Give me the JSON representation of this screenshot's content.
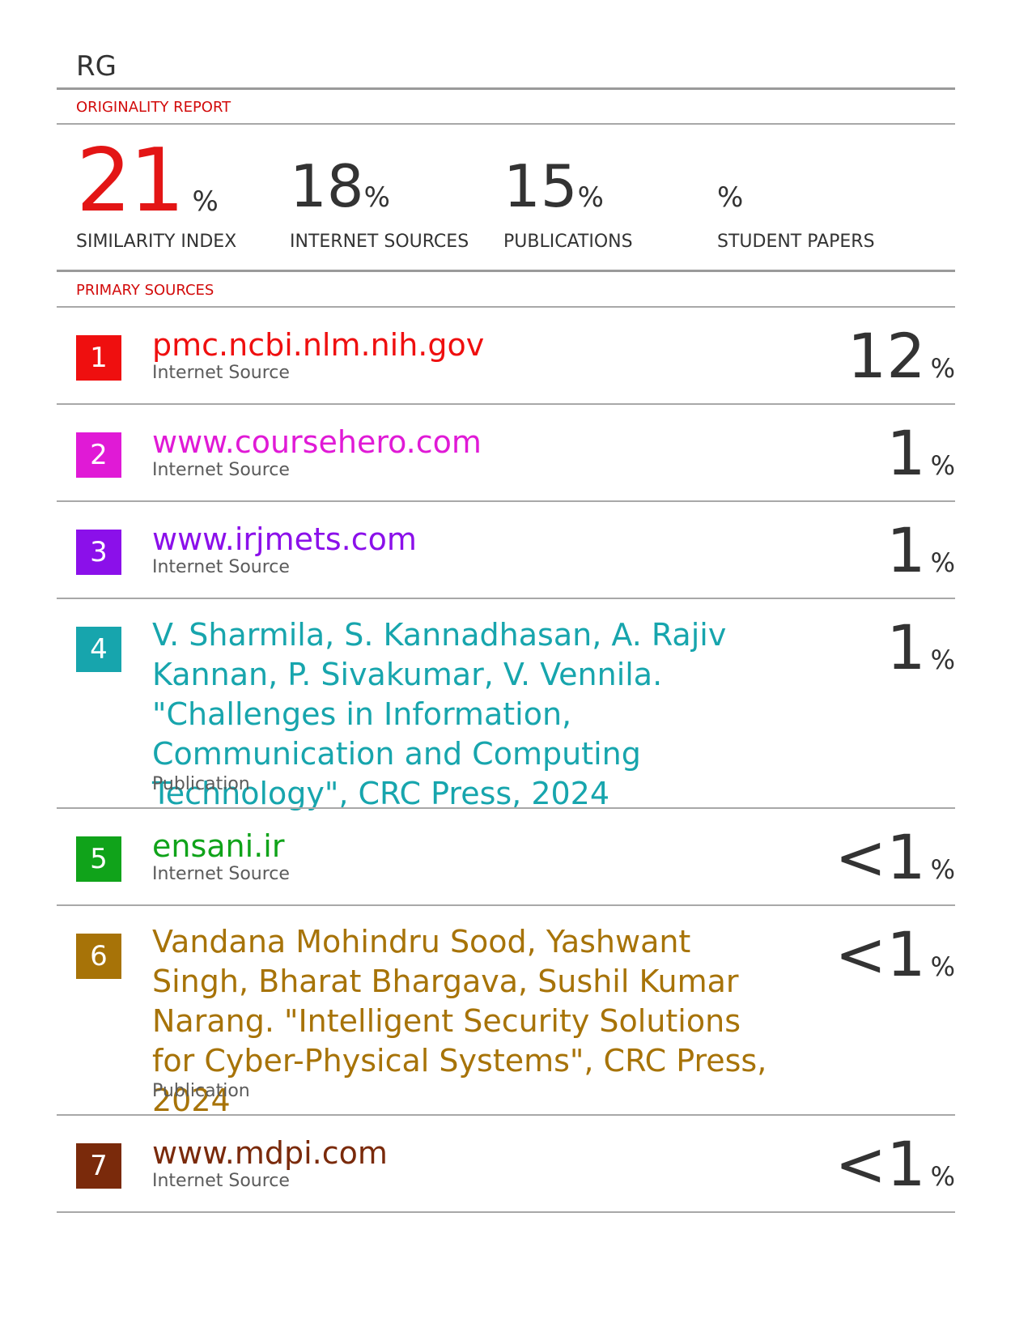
{
  "report_title": "RG",
  "originality_label": "ORIGINALITY REPORT",
  "primary_label": "PRIMARY SOURCES",
  "stats": {
    "similarity": {
      "value": "21",
      "unit": "%",
      "label": "SIMILARITY INDEX",
      "color": "#e31515"
    },
    "internet": {
      "value": "18",
      "unit": "%",
      "label": "INTERNET SOURCES"
    },
    "publications": {
      "value": "15",
      "unit": "%",
      "label": "PUBLICATIONS"
    },
    "student": {
      "value": "",
      "unit": "%",
      "label": "STUDENT PAPERS"
    }
  },
  "sources": [
    {
      "index": "1",
      "title": "pmc.ncbi.nlm.nih.gov",
      "type": "Internet Source",
      "percent": "12",
      "unit": "%",
      "color": "#ef0f0f"
    },
    {
      "index": "2",
      "title": "www.coursehero.com",
      "type": "Internet Source",
      "percent": "1",
      "unit": "%",
      "color": "#e01ad6"
    },
    {
      "index": "3",
      "title": "www.irjmets.com",
      "type": "Internet Source",
      "percent": "1",
      "unit": "%",
      "color": "#8b10ea"
    },
    {
      "index": "4",
      "title": "V. Sharmila, S. Kannadhasan, A. Rajiv Kannan, P. Sivakumar, V. Vennila. \"Challenges in Information, Communication and Computing Technology\", CRC Press, 2024",
      "type": "Publication",
      "percent": "1",
      "unit": "%",
      "color": "#17a5ad"
    },
    {
      "index": "5",
      "title": "ensani.ir",
      "type": "Internet Source",
      "percent": "<1",
      "unit": "%",
      "color": "#10a31a"
    },
    {
      "index": "6",
      "title": "Vandana Mohindru Sood, Yashwant Singh, Bharat Bhargava, Sushil Kumar Narang. \"Intelligent Security Solutions for Cyber-Physical Systems\", CRC Press, 2024",
      "type": "Publication",
      "percent": "<1",
      "unit": "%",
      "color": "#a77308"
    },
    {
      "index": "7",
      "title": "www.mdpi.com",
      "type": "Internet Source",
      "percent": "<1",
      "unit": "%",
      "color": "#7a2a0b"
    }
  ]
}
